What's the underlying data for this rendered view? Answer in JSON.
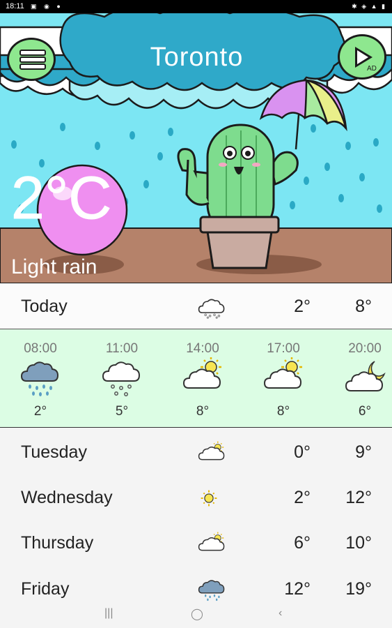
{
  "status": {
    "time": "18:11",
    "left_icons": "▣ ◉ ●",
    "right_icons": "✱ ◈ ▲ ▮"
  },
  "header": {
    "city": "Toronto",
    "menu_icon": "hamburger-icon",
    "ad_label": "AD"
  },
  "current": {
    "temperature": "2°C",
    "condition": "Light rain"
  },
  "today": {
    "label": "Today",
    "icon": "light-rain-icon",
    "low": "2°",
    "high": "8°"
  },
  "hourly": [
    {
      "time": "08:00",
      "icon": "rain-cloud-icon",
      "temp": "2°"
    },
    {
      "time": "11:00",
      "icon": "light-rain-icon",
      "temp": "5°"
    },
    {
      "time": "14:00",
      "icon": "partly-sunny-icon",
      "temp": "8°"
    },
    {
      "time": "17:00",
      "icon": "partly-sunny-icon",
      "temp": "8°"
    },
    {
      "time": "20:00",
      "icon": "partly-cloudy-night-icon",
      "temp": "6°"
    }
  ],
  "daily": [
    {
      "day": "Tuesday",
      "icon": "partly-sunny-icon",
      "low": "0°",
      "high": "9°"
    },
    {
      "day": "Wednesday",
      "icon": "sun-icon",
      "low": "2°",
      "high": "12°"
    },
    {
      "day": "Thursday",
      "icon": "partly-sunny-icon",
      "low": "6°",
      "high": "10°"
    },
    {
      "day": "Friday",
      "icon": "rain-cloud-icon",
      "low": "12°",
      "high": "19°"
    }
  ],
  "colors": {
    "sky": "#7ce6f3",
    "cloud_top": "#2fa9c9",
    "ground": "#b5826a",
    "hourly_bg": "#dcfde4",
    "button": "#8ee78f"
  },
  "nav": {
    "recent": "|||",
    "home": "◯",
    "back": "‹"
  }
}
